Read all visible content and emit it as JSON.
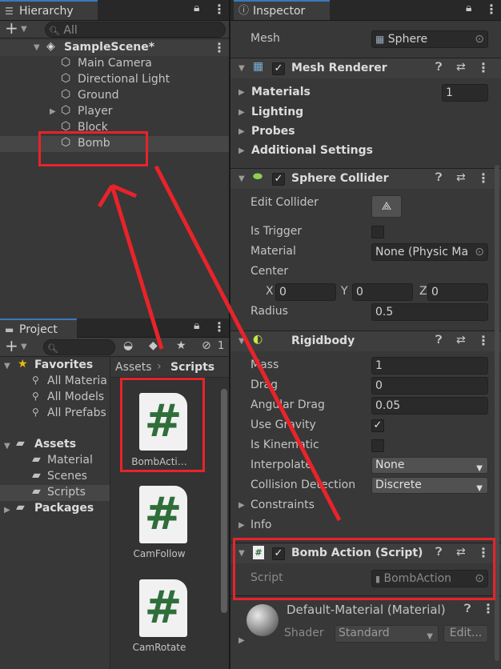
{
  "hierarchy": {
    "tab": "Hierarchy",
    "search_placeholder": "All",
    "scene": "SampleScene*",
    "items": [
      "Main Camera",
      "Directional Light",
      "Ground",
      "Player",
      "Block",
      "Bomb"
    ]
  },
  "project": {
    "tab": "Project",
    "favorites_label": "Favorites",
    "favorites": [
      "All Materia",
      "All Models",
      "All Prefabs"
    ],
    "assets_label": "Assets",
    "asset_folders": [
      "Material",
      "Scenes",
      "Scripts"
    ],
    "packages_label": "Packages",
    "breadcrumb_root": "Assets",
    "breadcrumb_current": "Scripts",
    "hidden_count": "1",
    "files": [
      "BombActi…",
      "CamFollow",
      "CamRotate"
    ],
    "file_glyph": "#"
  },
  "inspector": {
    "tab": "Inspector",
    "mesh_label": "Mesh",
    "mesh_value": "Sphere",
    "mesh_renderer": {
      "title": "Mesh Renderer",
      "materials_label": "Materials",
      "materials_count": "1",
      "lighting_label": "Lighting",
      "probes_label": "Probes",
      "additional_label": "Additional Settings"
    },
    "sphere_collider": {
      "title": "Sphere Collider",
      "edit_collider_label": "Edit Collider",
      "is_trigger_label": "Is Trigger",
      "material_label": "Material",
      "material_value": "None (Physic Ma",
      "center_label": "Center",
      "x_label": "X",
      "x": "0",
      "y_label": "Y",
      "y": "0",
      "z_label": "Z",
      "z": "0",
      "radius_label": "Radius",
      "radius": "0.5"
    },
    "rigidbody": {
      "title": "Rigidbody",
      "mass_label": "Mass",
      "mass": "1",
      "drag_label": "Drag",
      "drag": "0",
      "angular_drag_label": "Angular Drag",
      "angular_drag": "0.05",
      "use_gravity_label": "Use Gravity",
      "is_kinematic_label": "Is Kinematic",
      "interpolate_label": "Interpolate",
      "interpolate_value": "None",
      "collision_label": "Collision Detection",
      "collision_value": "Discrete",
      "constraints_label": "Constraints",
      "info_label": "Info"
    },
    "bomb_action": {
      "title": "Bomb Action (Script)",
      "script_label": "Script",
      "script_value": "BombAction"
    },
    "material": {
      "title": "Default-Material (Material)",
      "shader_label": "Shader",
      "shader_value": "Standard",
      "edit_label": "Edit..."
    }
  },
  "colors": {
    "annotation": "#e8232a",
    "accent": "#3a79bb"
  }
}
